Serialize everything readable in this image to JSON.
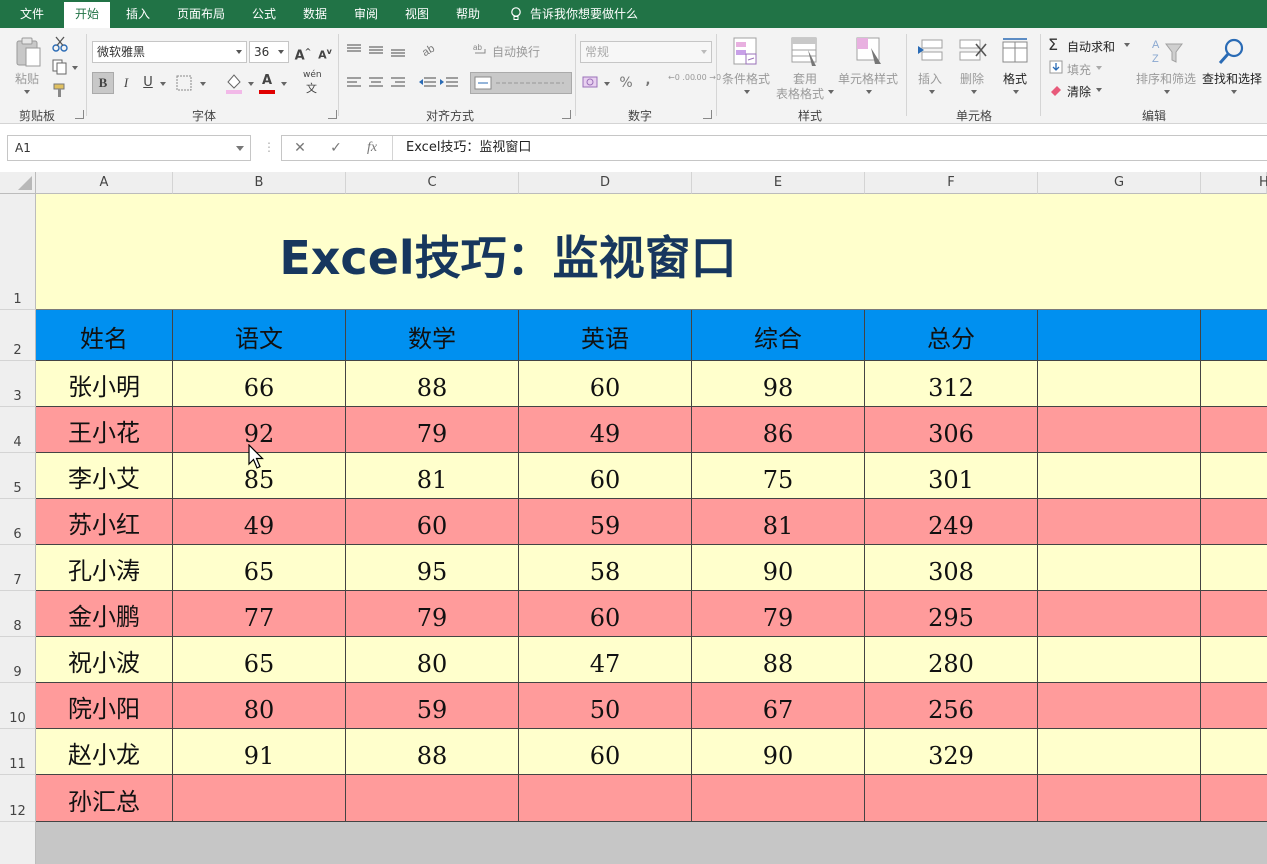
{
  "menu": {
    "items": [
      "文件",
      "开始",
      "插入",
      "页面布局",
      "公式",
      "数据",
      "审阅",
      "视图",
      "帮助"
    ],
    "active_index": 1,
    "tell_me": "告诉我你想要做什么"
  },
  "ribbon": {
    "clipboard": {
      "paste": "粘贴",
      "label": "剪贴板"
    },
    "font": {
      "name": "微软雅黑",
      "size": "36",
      "bold": "B",
      "italic": "I",
      "underline": "U",
      "label": "字体",
      "color_glyph": "A",
      "phonetic_top": "wén",
      "phonetic_bottom": "文"
    },
    "alignment": {
      "wrap_text": "自动换行",
      "label": "对齐方式"
    },
    "number": {
      "format": "常规",
      "percent": "%",
      "comma": ",",
      "inc_dec": "←0 .00",
      "dec_dec": ".00 →0",
      "label": "数字"
    },
    "styles": {
      "conditional": "条件格式",
      "table_line1": "套用",
      "table_line2": "表格格式",
      "cell_styles": "单元格样式",
      "label": "样式"
    },
    "cells": {
      "insert": "插入",
      "delete": "删除",
      "format": "格式",
      "label": "单元格"
    },
    "editing": {
      "autosum": "自动求和",
      "fill": "填充",
      "clear": "清除",
      "sort": "排序和筛选",
      "find": "查找和选择",
      "label": "编辑"
    }
  },
  "formula_bar": {
    "name_box": "A1",
    "cancel": "✕",
    "enter": "✓",
    "fx": "fx",
    "formula": "Excel技巧：监视窗口"
  },
  "sheet": {
    "columns": [
      "A",
      "B",
      "C",
      "D",
      "E",
      "F",
      "G",
      "H"
    ],
    "rows": [
      "1",
      "2",
      "3",
      "4",
      "5",
      "6",
      "7",
      "8",
      "9",
      "10",
      "11",
      "12"
    ],
    "title": "Excel技巧：监视窗口",
    "headers": [
      "姓名",
      "语文",
      "数学",
      "英语",
      "综合",
      "总分"
    ],
    "data": [
      [
        "张小明",
        "66",
        "88",
        "60",
        "98",
        "312"
      ],
      [
        "王小花",
        "92",
        "79",
        "49",
        "86",
        "306"
      ],
      [
        "李小艾",
        "85",
        "81",
        "60",
        "75",
        "301"
      ],
      [
        "苏小红",
        "49",
        "60",
        "59",
        "81",
        "249"
      ],
      [
        "孔小涛",
        "65",
        "95",
        "58",
        "90",
        "308"
      ],
      [
        "金小鹏",
        "77",
        "79",
        "60",
        "79",
        "295"
      ],
      [
        "祝小波",
        "65",
        "80",
        "47",
        "88",
        "280"
      ],
      [
        "院小阳",
        "80",
        "59",
        "50",
        "67",
        "256"
      ],
      [
        "赵小龙",
        "91",
        "88",
        "60",
        "90",
        "329"
      ],
      [
        "孙汇总",
        "",
        "",
        "",
        "",
        ""
      ]
    ],
    "colors": {
      "header_fill": "#0090f0",
      "odd_fill": "#ffffcc",
      "even_fill": "#ff9b9b",
      "title_color": "#17375e"
    }
  }
}
